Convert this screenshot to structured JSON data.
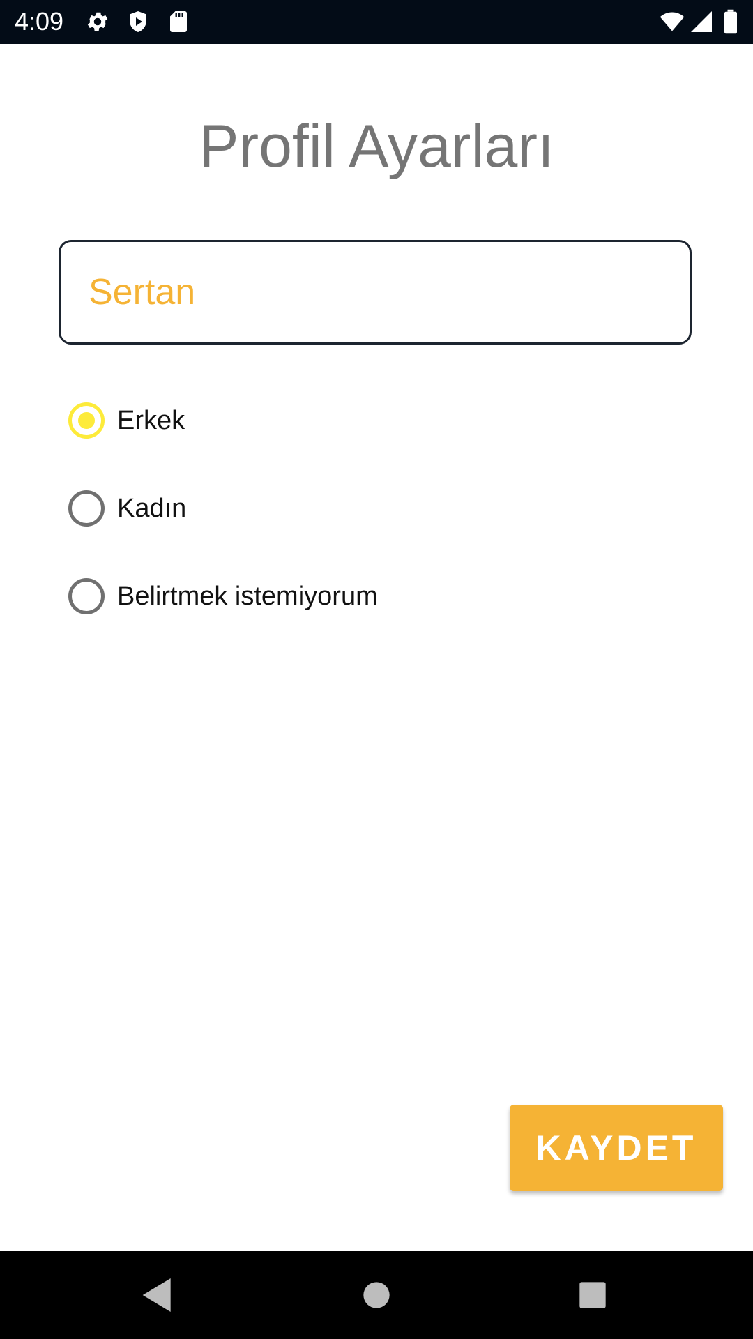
{
  "status_bar": {
    "time": "4:09",
    "icons": [
      "settings-icon",
      "shield-play-icon",
      "sd-card-icon",
      "wifi-icon",
      "signal-icon",
      "battery-icon"
    ]
  },
  "title": "Profil Ayarları",
  "name_input": {
    "value": "Sertan",
    "text_color": "#f5b335"
  },
  "gender_options": [
    {
      "label": "Erkek",
      "selected": true
    },
    {
      "label": "Kadın",
      "selected": false
    },
    {
      "label": "Belirtmek istemiyorum",
      "selected": false
    }
  ],
  "save_button": {
    "label": "KAYDET"
  },
  "nav_bar": {
    "icons": [
      "back-icon",
      "home-icon",
      "recents-icon"
    ]
  },
  "colors": {
    "accent": "#f5b335",
    "radio_selected": "#fdeb3a",
    "status_bar_bg": "#030c17",
    "title_text": "#757575"
  }
}
